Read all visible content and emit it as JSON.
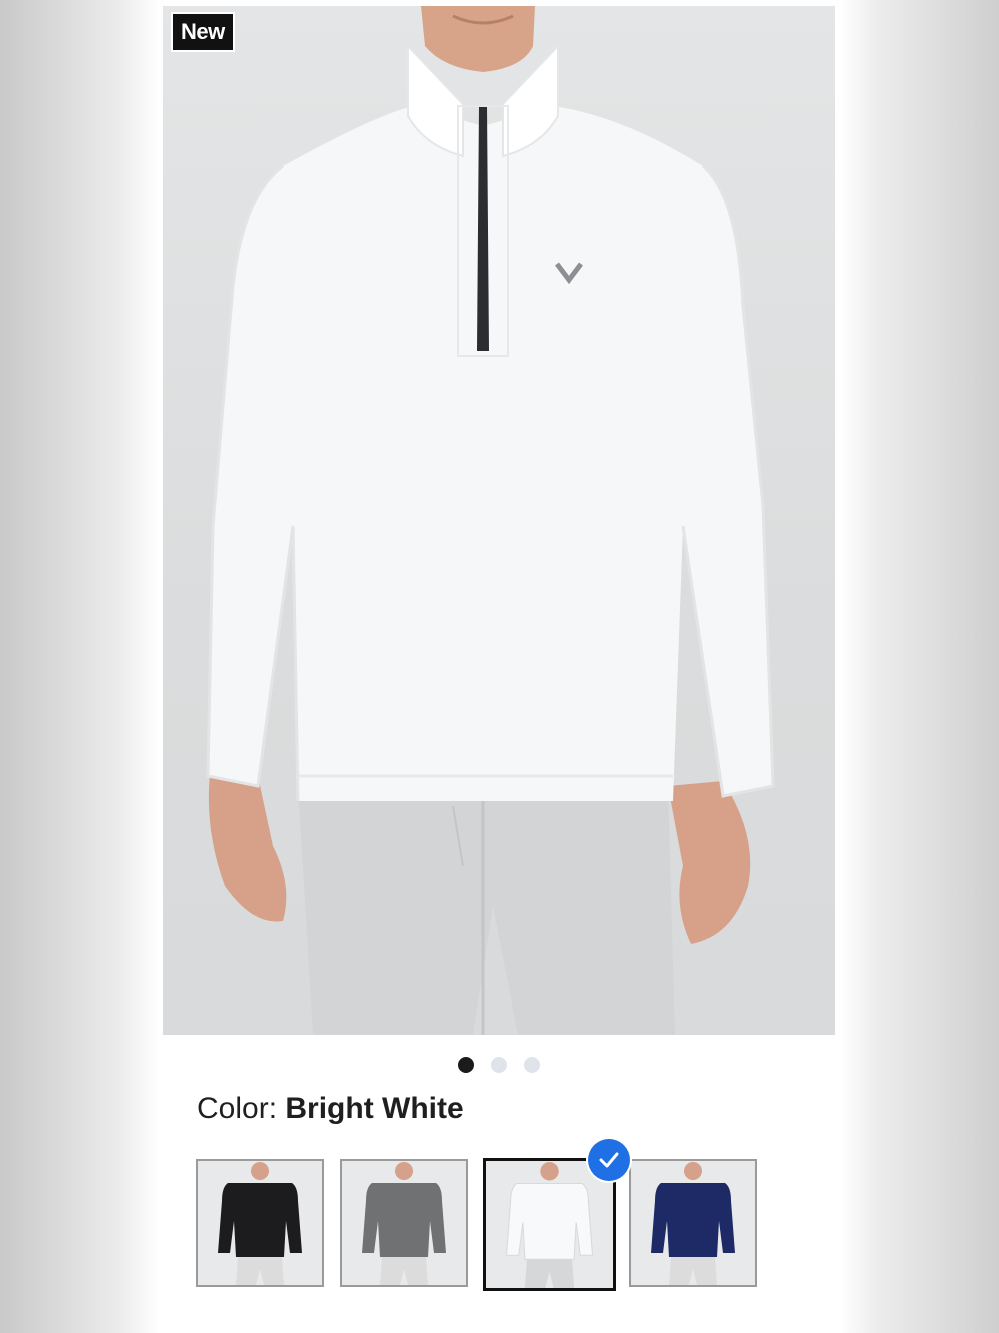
{
  "badge": {
    "label": "New"
  },
  "gallery": {
    "dot_count": 3,
    "active_index": 0
  },
  "color": {
    "label": "Color:",
    "value": "Bright White"
  },
  "swatches": [
    {
      "name": "Black",
      "shirt": "#1c1c1e",
      "selected": false
    },
    {
      "name": "Gray",
      "shirt": "#6f7173",
      "selected": false
    },
    {
      "name": "Bright White",
      "shirt": "#f4f5f6",
      "selected": true
    },
    {
      "name": "Navy",
      "shirt": "#1d2a66",
      "selected": false
    }
  ],
  "colors": {
    "background": "#dcdedf",
    "shirt": "#f5f6f7",
    "pants": "#d3d4d6",
    "skin": "#d8a48b",
    "accent_check": "#1f6fe5"
  },
  "icons": [
    "chevron-logo-icon",
    "checkmark-icon"
  ]
}
